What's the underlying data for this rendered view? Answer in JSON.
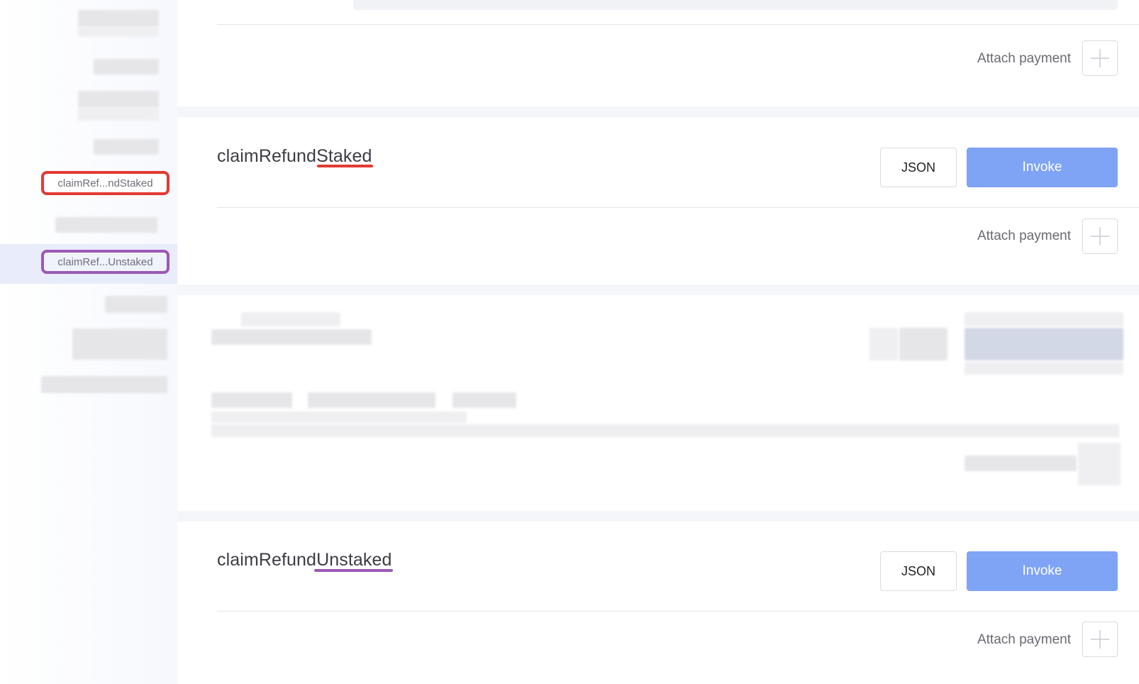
{
  "sidebar": {
    "items": [
      {
        "label": "claimRef...ndStaked",
        "highlight": "red"
      },
      {
        "label": "claimRef...Unstaked",
        "highlight": "purple",
        "active": true
      }
    ]
  },
  "functions": [
    {
      "name_prefix": "claimRefund",
      "name_suffix": "Staked",
      "underline_color": "#e23a33"
    },
    {
      "name_prefix": "claimRefund",
      "name_suffix": "Unstaked",
      "underline_color": "#9b59b6"
    }
  ],
  "buttons": {
    "json": "JSON",
    "invoke": "Invoke",
    "attach_payment": "Attach payment"
  },
  "icons": {
    "attach": "plus-icon"
  },
  "colors": {
    "invoke_bg": "#7fa4f6",
    "red_highlight": "#e23a33",
    "purple_highlight": "#9b59b6"
  }
}
